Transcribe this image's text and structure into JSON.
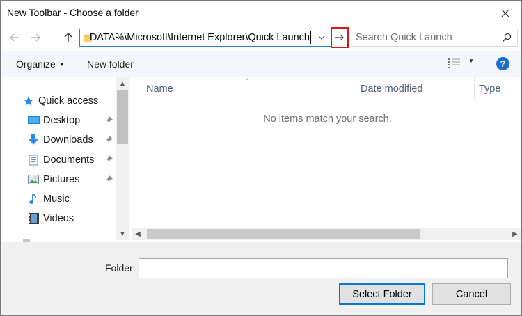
{
  "window": {
    "title": "New Toolbar - Choose a folder"
  },
  "address": {
    "path": "DATA%\\Microsoft\\Internet Explorer\\Quick Launch",
    "search_placeholder": "Search Quick Launch"
  },
  "toolbar": {
    "organize_label": "Organize",
    "new_folder_label": "New folder",
    "help_label": "?"
  },
  "nav": {
    "items": [
      {
        "label": "Quick access",
        "icon": "star-icon",
        "pinned": false
      },
      {
        "label": "Desktop",
        "icon": "desktop-icon",
        "pinned": true
      },
      {
        "label": "Downloads",
        "icon": "downloads-icon",
        "pinned": true
      },
      {
        "label": "Documents",
        "icon": "documents-icon",
        "pinned": true
      },
      {
        "label": "Pictures",
        "icon": "pictures-icon",
        "pinned": true
      },
      {
        "label": "Music",
        "icon": "music-icon",
        "pinned": false
      },
      {
        "label": "Videos",
        "icon": "videos-icon",
        "pinned": false
      }
    ]
  },
  "columns": {
    "name": "Name",
    "date_modified": "Date modified",
    "type": "Type"
  },
  "content": {
    "empty_message": "No items match your search."
  },
  "footer": {
    "folder_label": "Folder:",
    "folder_value": "",
    "select_button": "Select Folder",
    "cancel_button": "Cancel"
  },
  "colors": {
    "accent": "#0078d7",
    "highlight_box": "#d11a1a",
    "toolbar_bg": "#f3f6fb",
    "footer_bg": "#f0f0f0"
  }
}
